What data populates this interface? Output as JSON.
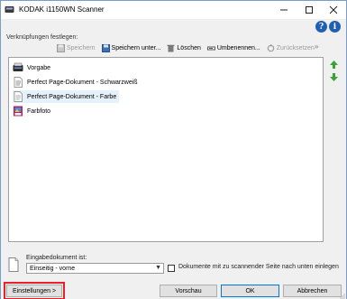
{
  "window": {
    "title": "KODAK i1150WN Scanner",
    "minimize_icon": "minimize-icon",
    "maximize_icon": "maximize-icon",
    "close_icon": "close-icon",
    "help_label": "?",
    "info_label": "i"
  },
  "shortcuts": {
    "label": "Verknüpfungen festlegen:",
    "toolbar": {
      "save_label": "Speichern",
      "save_as_label": "Speichern unter...",
      "delete_label": "Löschen",
      "rename_label": "Umbenennen...",
      "reset_label": "Zurücksetzen",
      "more_label": "»"
    },
    "items": [
      {
        "label": "Vorgabe",
        "icon": "scanner-icon"
      },
      {
        "label": "Perfect Page-Dokument - Schwarzweiß",
        "icon": "document-bw-icon"
      },
      {
        "label": "Perfect Page-Dokument - Farbe",
        "icon": "document-color-icon",
        "selected": true
      },
      {
        "label": "Farbfoto",
        "icon": "photo-icon"
      }
    ]
  },
  "input": {
    "label": "Eingabedokument ist:",
    "selected_value": "Einseitig - vorne",
    "checkbox_label": "Dokumente mit zu scannender Seite nach unten einlegen",
    "checkbox_checked": false
  },
  "footer": {
    "settings_label": "Einstellungen >",
    "preview_label": "Vorschau",
    "ok_label": "OK",
    "cancel_label": "Abbrechen"
  },
  "colors": {
    "accent": "#0078d7",
    "selection": "#e5f1fb",
    "highlight_frame": "#e8202a",
    "arrow_green": "#3aa335"
  }
}
